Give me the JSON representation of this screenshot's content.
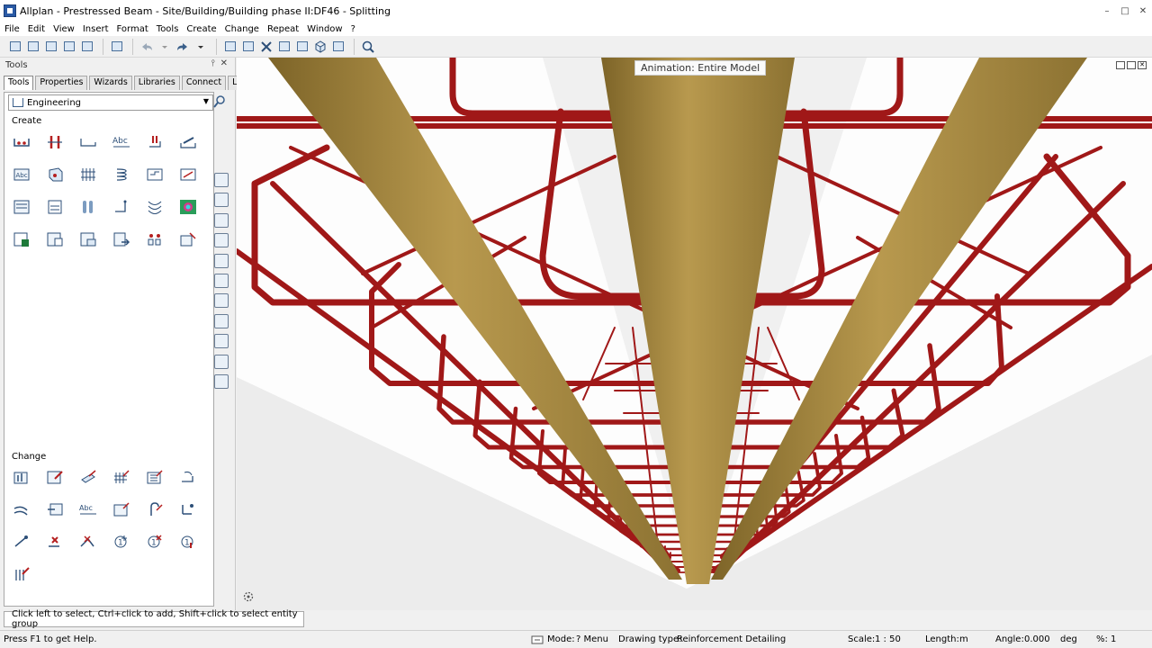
{
  "window": {
    "title": "Allplan - Prestressed Beam - Site/Building/Building phase II:DF46 - Splitting",
    "min": "–",
    "max": "□",
    "close": "✕"
  },
  "menu": [
    "File",
    "Edit",
    "View",
    "Insert",
    "Format",
    "Tools",
    "Create",
    "Change",
    "Repeat",
    "Window",
    "?"
  ],
  "toolbar": {
    "icons": [
      "new-doc-icon",
      "open-project-icon",
      "open-files-icon",
      "save-icon",
      "plot-icon",
      "layout-icon",
      "undo-icon",
      "redo-icon",
      "measure-icon",
      "snap-icon",
      "delete-icon",
      "copy-icon",
      "mirror-icon",
      "view-3d-icon",
      "layers-icon",
      "help-icon"
    ]
  },
  "panel": {
    "title": "Tools",
    "pin": "⫯",
    "close": "✕",
    "tabs": [
      "Tools",
      "Properties",
      "Wizards",
      "Libraries",
      "Connect",
      "Layers"
    ],
    "active_tab": 0,
    "family": "Engineering",
    "sections": {
      "create": "Create",
      "change": "Change"
    }
  },
  "viewport": {
    "animation_label": "Animation: Entire Model",
    "colors": {
      "rebar": "#a01818",
      "strand": "#a88a45",
      "background": "#ffffff"
    }
  },
  "command_line": "Click left to select, Ctrl+click to add, Shift+click to select entity group",
  "status": {
    "help": "Press F1 to get Help.",
    "mode": "Mode:",
    "menu": "? Menu",
    "drawing_type_label": "Drawing type:",
    "drawing_type": "Reinforcement Detailing",
    "scale_label": "Scale:",
    "scale": "1 : 50",
    "length_label": "Length:",
    "length_unit": "m",
    "angle_label": "Angle:",
    "angle": "0.000",
    "angle_unit": "deg",
    "percent_label": "%:",
    "percent": "1"
  }
}
